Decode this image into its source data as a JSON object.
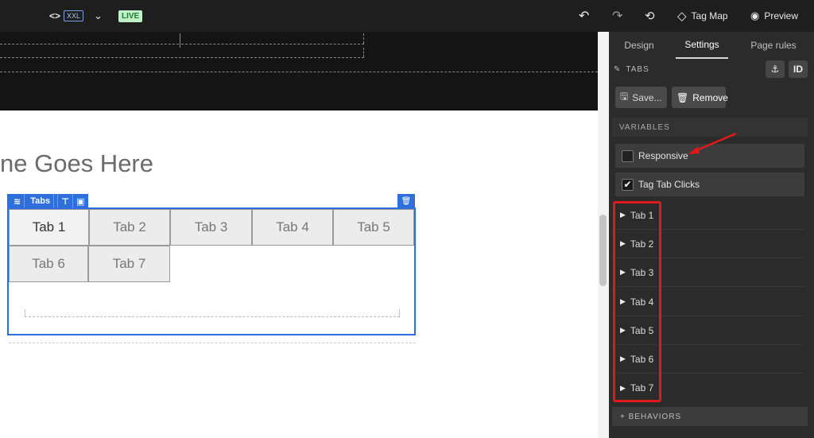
{
  "topbar": {
    "code_icon": "<>",
    "breakpoint": "XXL",
    "chevron": "⌄",
    "live_badge": "LIVE",
    "undo": "↶",
    "redo": "↷",
    "history": "⟲",
    "tag_map_icon": "◇",
    "tag_map_label": "Tag Map",
    "preview_icon": "◉",
    "preview_label": "Preview"
  },
  "canvas": {
    "heading": "ne Goes Here",
    "tabs_toolbar": {
      "label": "Tabs",
      "layers_icon": "≋",
      "pin_icon": "⊤",
      "layout_icon": "▣",
      "delete_icon": "🗑"
    },
    "tabs": [
      "Tab 1",
      "Tab 2",
      "Tab 3",
      "Tab 4",
      "Tab 5",
      "Tab 6",
      "Tab 7"
    ]
  },
  "panel": {
    "tabs": [
      "Design",
      "Settings",
      "Page rules"
    ],
    "active_tab": "Settings",
    "component_title": "TABS",
    "anchor_icon": "⚓",
    "id_label": "ID",
    "save_label": "Save...",
    "remove_label": "Remove",
    "variables_header": "VARIABLES",
    "responsive_label": "Responsive",
    "tag_tab_clicks_label": "Tag Tab Clicks",
    "checkmark": "✔",
    "tab_items": [
      "Tab 1",
      "Tab 2",
      "Tab 3",
      "Tab 4",
      "Tab 5",
      "Tab 6",
      "Tab 7"
    ],
    "behaviors_label": "+ BEHAVIORS",
    "triangle": "▶",
    "pencil_icon": "✎",
    "save_icon": "🖫",
    "trash_icon": "🗑"
  },
  "colors": {
    "accent_blue": "#2f6fdd",
    "annotation_red": "#e01a1a",
    "live_green": "#bff0c8"
  }
}
